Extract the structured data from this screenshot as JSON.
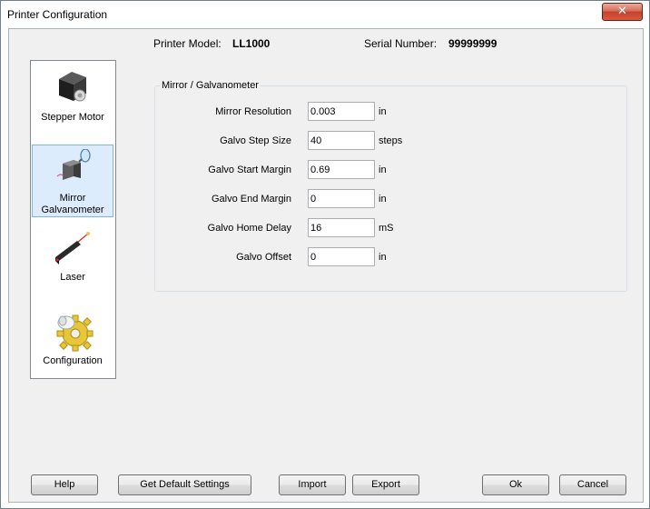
{
  "window": {
    "title": "Printer Configuration",
    "close_glyph": "✕"
  },
  "header": {
    "model_label": "Printer Model:",
    "model_value": "LL1000",
    "serial_label": "Serial Number:",
    "serial_value": "99999999"
  },
  "sidebar": {
    "items": [
      {
        "label": "Stepper Motor",
        "icon": "stepper-motor-icon"
      },
      {
        "label_line1": "Mirror",
        "label_line2": "Galvanometer",
        "icon": "mirror-galvanometer-icon",
        "selected": true
      },
      {
        "label": "Laser",
        "icon": "laser-icon"
      },
      {
        "label": "Configuration",
        "icon": "configuration-gear-icon"
      }
    ]
  },
  "panel": {
    "group_title": "Mirror / Galvanometer",
    "fields": [
      {
        "label": "Mirror Resolution",
        "value": "0.003",
        "unit": "in"
      },
      {
        "label": "Galvo Step Size",
        "value": "40",
        "unit": "steps"
      },
      {
        "label": "Galvo Start Margin",
        "value": "0.69",
        "unit": "in"
      },
      {
        "label": "Galvo End Margin",
        "value": "0",
        "unit": "in"
      },
      {
        "label": "Galvo Home Delay",
        "value": "16",
        "unit": "mS"
      },
      {
        "label": "Galvo Offset",
        "value": "0",
        "unit": "in"
      }
    ]
  },
  "buttons": {
    "help": "Help",
    "get_default": "Get Default Settings",
    "import": "Import",
    "export": "Export",
    "ok": "Ok",
    "cancel": "Cancel"
  },
  "colors": {
    "selected_bg": "#dcecfc",
    "selected_border": "#7eb4ea",
    "close_button": "#c7412a"
  }
}
